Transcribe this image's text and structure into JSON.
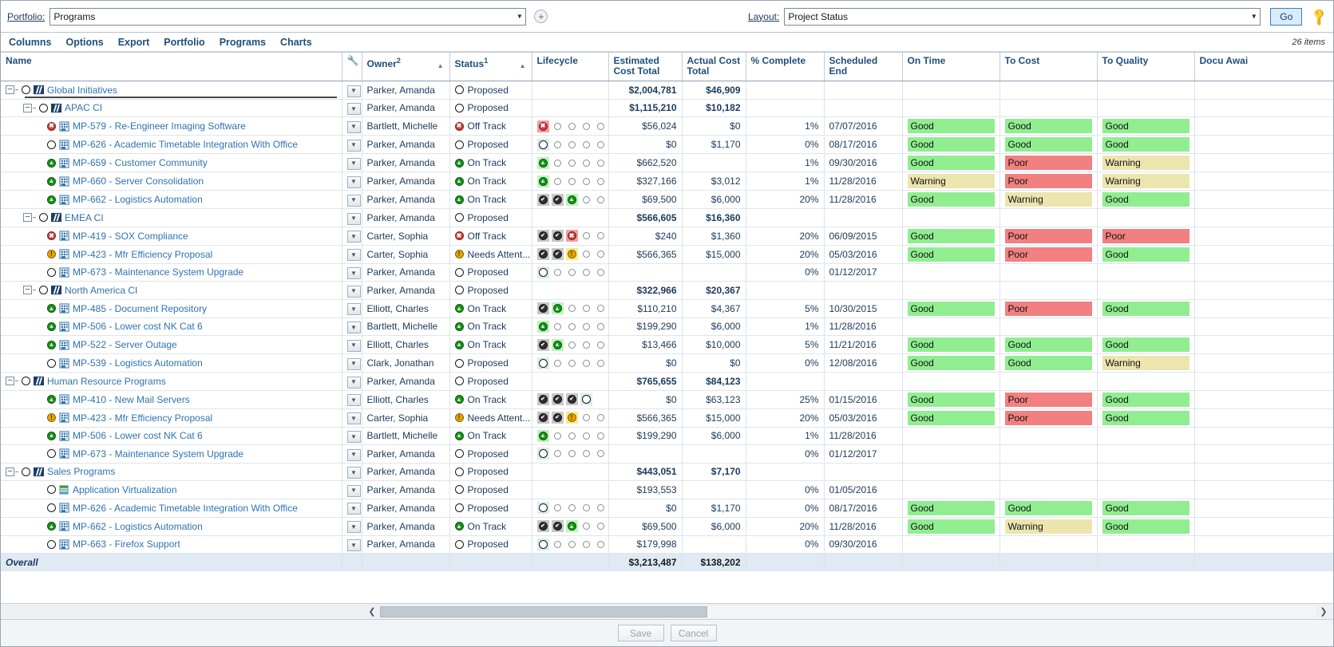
{
  "topbar": {
    "portfolio_label": "Portfolio:",
    "portfolio_value": "Programs",
    "add_portfolio_icon": "plus-circle-icon",
    "layout_label": "Layout:",
    "layout_value": "Project Status",
    "go_label": "Go",
    "key_icon": "key-icon"
  },
  "menubar": {
    "items": [
      {
        "label": "Columns"
      },
      {
        "label": "Options"
      },
      {
        "label": "Export"
      },
      {
        "label": "Portfolio"
      },
      {
        "label": "Programs"
      },
      {
        "label": "Charts"
      }
    ],
    "item_count": "26 items"
  },
  "columns": [
    {
      "label": "Name",
      "sort": ""
    },
    {
      "label": "",
      "icon": "wrench-icon",
      "sort": ""
    },
    {
      "label": "Owner",
      "sup": "2",
      "sort": "asc"
    },
    {
      "label": "Status",
      "sup": "1",
      "sort": "asc"
    },
    {
      "label": "Lifecycle",
      "sort": ""
    },
    {
      "label": "Estimated Cost Total",
      "sort": ""
    },
    {
      "label": "Actual Cost Total",
      "sort": ""
    },
    {
      "label": "% Complete",
      "sort": ""
    },
    {
      "label": "Scheduled End",
      "sort": ""
    },
    {
      "label": "On Time",
      "sort": ""
    },
    {
      "label": "To Cost",
      "sort": ""
    },
    {
      "label": "To Quality",
      "sort": ""
    },
    {
      "label": "Docu Awai",
      "sort": "asc"
    }
  ],
  "rows": [
    {
      "level": 0,
      "expander": true,
      "dot": "open",
      "icon": "program-icon",
      "name": "Global Initiatives",
      "group": true,
      "titlerule": true,
      "owner": "Parker, Amanda",
      "status_glyph": "open",
      "status": "Proposed",
      "lifecycle": [],
      "est": "$2,004,781",
      "act": "$46,909",
      "pct": "",
      "end": "",
      "ontime": "",
      "tocost": "",
      "toquality": ""
    },
    {
      "level": 1,
      "expander": true,
      "dot": "open",
      "icon": "program-icon",
      "name": "APAC CI",
      "group": true,
      "owner": "Parker, Amanda",
      "status_glyph": "open",
      "status": "Proposed",
      "lifecycle": [],
      "est": "$1,115,210",
      "act": "$10,182",
      "pct": "",
      "end": "",
      "ontime": "",
      "tocost": "",
      "toquality": ""
    },
    {
      "level": 2,
      "dot": "red",
      "icon": "project-icon",
      "name": "MP-579 - Re-Engineer Imaging Software",
      "owner": "Bartlett, Michelle",
      "status_glyph": "red",
      "status": "Off Track",
      "lifecycle": [
        "cur-red",
        "ring",
        "ring",
        "ring",
        "ring"
      ],
      "est": "$56,024",
      "act": "$0",
      "pct": "1%",
      "end": "07/07/2016",
      "ontime": "Good",
      "tocost": "Good",
      "toquality": "Good"
    },
    {
      "level": 2,
      "dot": "open",
      "icon": "project-icon",
      "name": "MP-626 - Academic Timetable Integration With Office",
      "owner": "Parker, Amanda",
      "status_glyph": "open",
      "status": "Proposed",
      "lifecycle": [
        "cur-empty",
        "ring",
        "ring",
        "ring",
        "ring"
      ],
      "est": "$0",
      "act": "$1,170",
      "pct": "0%",
      "end": "08/17/2016",
      "ontime": "Good",
      "tocost": "Good",
      "toquality": "Good"
    },
    {
      "level": 2,
      "dot": "green",
      "icon": "project-icon",
      "name": "MP-659 - Customer Community",
      "owner": "Parker, Amanda",
      "status_glyph": "green",
      "status": "On Track",
      "lifecycle": [
        "cur-green",
        "ring",
        "ring",
        "ring",
        "ring"
      ],
      "est": "$662,520",
      "act": "",
      "pct": "1%",
      "end": "09/30/2016",
      "ontime": "Good",
      "tocost": "Poor",
      "toquality": "Warning"
    },
    {
      "level": 2,
      "dot": "green",
      "icon": "project-icon",
      "name": "MP-660 - Server Consolidation",
      "owner": "Parker, Amanda",
      "status_glyph": "green",
      "status": "On Track",
      "lifecycle": [
        "cur-green",
        "ring",
        "ring",
        "ring",
        "ring"
      ],
      "est": "$327,166",
      "act": "$3,012",
      "pct": "1%",
      "end": "11/28/2016",
      "ontime": "Warning",
      "tocost": "Poor",
      "toquality": "Warning"
    },
    {
      "level": 2,
      "dot": "green",
      "icon": "project-icon",
      "name": "MP-662 - Logistics Automation",
      "owner": "Parker, Amanda",
      "status_glyph": "green",
      "status": "On Track",
      "lifecycle": [
        "check",
        "check",
        "cur-green",
        "ring",
        "ring"
      ],
      "est": "$69,500",
      "act": "$6,000",
      "pct": "20%",
      "end": "11/28/2016",
      "ontime": "Good",
      "tocost": "Warning",
      "toquality": "Good"
    },
    {
      "level": 1,
      "expander": true,
      "dot": "open",
      "icon": "program-icon",
      "name": "EMEA CI",
      "group": true,
      "owner": "Parker, Amanda",
      "status_glyph": "open",
      "status": "Proposed",
      "lifecycle": [],
      "est": "$566,605",
      "act": "$16,360",
      "pct": "",
      "end": "",
      "ontime": "",
      "tocost": "",
      "toquality": ""
    },
    {
      "level": 2,
      "dot": "red",
      "icon": "project-icon",
      "name": "MP-419 - SOX Compliance",
      "owner": "Carter, Sophia",
      "status_glyph": "red",
      "status": "Off Track",
      "lifecycle": [
        "check",
        "check",
        "cur-red",
        "ring",
        "ring"
      ],
      "est": "$240",
      "act": "$1,360",
      "pct": "20%",
      "end": "06/09/2015",
      "ontime": "Good",
      "tocost": "Poor",
      "toquality": "Poor"
    },
    {
      "level": 2,
      "dot": "amber",
      "icon": "project-icon",
      "name": "MP-423 - Mfr Efficiency Proposal",
      "owner": "Carter, Sophia",
      "status_glyph": "amber",
      "status": "Needs Attent...",
      "lifecycle": [
        "check",
        "check",
        "cur-amber",
        "ring",
        "ring"
      ],
      "est": "$566,365",
      "act": "$15,000",
      "pct": "20%",
      "end": "05/03/2016",
      "ontime": "Good",
      "tocost": "Poor",
      "toquality": "Good"
    },
    {
      "level": 2,
      "dot": "open",
      "icon": "project-icon",
      "name": "MP-673 - Maintenance System Upgrade",
      "owner": "Parker, Amanda",
      "status_glyph": "open",
      "status": "Proposed",
      "lifecycle": [
        "cur-empty",
        "ring",
        "ring",
        "ring",
        "ring"
      ],
      "est": "",
      "act": "",
      "pct": "0%",
      "end": "01/12/2017",
      "ontime": "",
      "tocost": "",
      "toquality": ""
    },
    {
      "level": 1,
      "expander": true,
      "dot": "open",
      "icon": "program-icon",
      "name": "North America CI",
      "group": true,
      "owner": "Parker, Amanda",
      "status_glyph": "open",
      "status": "Proposed",
      "lifecycle": [],
      "est": "$322,966",
      "act": "$20,367",
      "pct": "",
      "end": "",
      "ontime": "",
      "tocost": "",
      "toquality": ""
    },
    {
      "level": 2,
      "dot": "green",
      "icon": "project-icon",
      "name": "MP-485 - Document Repository",
      "owner": "Elliott, Charles",
      "status_glyph": "green",
      "status": "On Track",
      "lifecycle": [
        "check",
        "cur-green",
        "ring",
        "ring",
        "ring"
      ],
      "est": "$110,210",
      "act": "$4,367",
      "pct": "5%",
      "end": "10/30/2015",
      "ontime": "Good",
      "tocost": "Poor",
      "toquality": "Good"
    },
    {
      "level": 2,
      "dot": "green",
      "icon": "project-icon",
      "name": "MP-506 - Lower cost NK Cat 6",
      "owner": "Bartlett, Michelle",
      "status_glyph": "green",
      "status": "On Track",
      "lifecycle": [
        "cur-green",
        "ring",
        "ring",
        "ring",
        "ring"
      ],
      "est": "$199,290",
      "act": "$6,000",
      "pct": "1%",
      "end": "11/28/2016",
      "ontime": "",
      "tocost": "",
      "toquality": ""
    },
    {
      "level": 2,
      "dot": "green",
      "icon": "project-icon",
      "name": "MP-522 - Server Outage",
      "owner": "Elliott, Charles",
      "status_glyph": "green",
      "status": "On Track",
      "lifecycle": [
        "check",
        "cur-green",
        "ring",
        "ring",
        "ring"
      ],
      "est": "$13,466",
      "act": "$10,000",
      "pct": "5%",
      "end": "11/21/2016",
      "ontime": "Good",
      "tocost": "Good",
      "toquality": "Good"
    },
    {
      "level": 2,
      "dot": "open",
      "icon": "project-icon",
      "name": "MP-539 - Logistics Automation",
      "owner": "Clark, Jonathan",
      "status_glyph": "open",
      "status": "Proposed",
      "lifecycle": [
        "cur-empty",
        "ring",
        "ring",
        "ring",
        "ring"
      ],
      "est": "$0",
      "act": "$0",
      "pct": "0%",
      "end": "12/08/2016",
      "ontime": "Good",
      "tocost": "Good",
      "toquality": "Warning"
    },
    {
      "level": 0,
      "expander": true,
      "dot": "open",
      "icon": "program-icon",
      "name": "Human Resource Programs",
      "group": true,
      "owner": "Parker, Amanda",
      "status_glyph": "open",
      "status": "Proposed",
      "lifecycle": [],
      "est": "$765,655",
      "act": "$84,123",
      "pct": "",
      "end": "",
      "ontime": "",
      "tocost": "",
      "toquality": ""
    },
    {
      "level": 2,
      "dot": "green",
      "icon": "project-icon",
      "name": "MP-410 - New Mail Servers",
      "owner": "Elliott, Charles",
      "status_glyph": "green",
      "status": "On Track",
      "lifecycle": [
        "check",
        "done",
        "check",
        "cur-empty"
      ],
      "est": "$0",
      "act": "$63,123",
      "pct": "25%",
      "end": "01/15/2016",
      "ontime": "Good",
      "tocost": "Poor",
      "toquality": "Good"
    },
    {
      "level": 2,
      "dot": "amber",
      "icon": "project-icon",
      "name": "MP-423 - Mfr Efficiency Proposal",
      "owner": "Carter, Sophia",
      "status_glyph": "amber",
      "status": "Needs Attent...",
      "lifecycle": [
        "check",
        "check",
        "cur-amber",
        "ring",
        "ring"
      ],
      "est": "$566,365",
      "act": "$15,000",
      "pct": "20%",
      "end": "05/03/2016",
      "ontime": "Good",
      "tocost": "Poor",
      "toquality": "Good"
    },
    {
      "level": 2,
      "dot": "green",
      "icon": "project-icon",
      "name": "MP-506 - Lower cost NK Cat 6",
      "owner": "Bartlett, Michelle",
      "status_glyph": "green",
      "status": "On Track",
      "lifecycle": [
        "cur-green",
        "ring",
        "ring",
        "ring",
        "ring"
      ],
      "est": "$199,290",
      "act": "$6,000",
      "pct": "1%",
      "end": "11/28/2016",
      "ontime": "",
      "tocost": "",
      "toquality": ""
    },
    {
      "level": 2,
      "dot": "open",
      "icon": "project-icon",
      "name": "MP-673 - Maintenance System Upgrade",
      "owner": "Parker, Amanda",
      "status_glyph": "open",
      "status": "Proposed",
      "lifecycle": [
        "cur-empty",
        "ring",
        "ring",
        "ring",
        "ring"
      ],
      "est": "",
      "act": "",
      "pct": "0%",
      "end": "01/12/2017",
      "ontime": "",
      "tocost": "",
      "toquality": ""
    },
    {
      "level": 0,
      "expander": true,
      "dot": "open",
      "icon": "program-icon",
      "name": "Sales Programs",
      "group": true,
      "owner": "Parker, Amanda",
      "status_glyph": "open",
      "status": "Proposed",
      "lifecycle": [],
      "est": "$443,051",
      "act": "$7,170",
      "pct": "",
      "end": "",
      "ontime": "",
      "tocost": "",
      "toquality": ""
    },
    {
      "level": 2,
      "dot": "open",
      "icon": "app-icon",
      "name": "Application Virtualization",
      "owner": "Parker, Amanda",
      "status_glyph": "open",
      "status": "Proposed",
      "lifecycle": [],
      "est": "$193,553",
      "act": "",
      "pct": "0%",
      "end": "01/05/2016",
      "ontime": "",
      "tocost": "",
      "toquality": ""
    },
    {
      "level": 2,
      "dot": "open",
      "icon": "project-icon",
      "name": "MP-626 - Academic Timetable Integration With Office",
      "owner": "Parker, Amanda",
      "status_glyph": "open",
      "status": "Proposed",
      "lifecycle": [
        "cur-empty",
        "ring",
        "ring",
        "ring",
        "ring"
      ],
      "est": "$0",
      "act": "$1,170",
      "pct": "0%",
      "end": "08/17/2016",
      "ontime": "Good",
      "tocost": "Good",
      "toquality": "Good"
    },
    {
      "level": 2,
      "dot": "green",
      "icon": "project-icon",
      "name": "MP-662 - Logistics Automation",
      "owner": "Parker, Amanda",
      "status_glyph": "green",
      "status": "On Track",
      "lifecycle": [
        "check",
        "check",
        "cur-green",
        "ring",
        "ring"
      ],
      "est": "$69,500",
      "act": "$6,000",
      "pct": "20%",
      "end": "11/28/2016",
      "ontime": "Good",
      "tocost": "Warning",
      "toquality": "Good"
    },
    {
      "level": 2,
      "dot": "open",
      "icon": "project-icon",
      "name": "MP-663 - Firefox Support",
      "owner": "Parker, Amanda",
      "status_glyph": "open",
      "status": "Proposed",
      "lifecycle": [
        "cur-empty",
        "ring",
        "ring",
        "ring",
        "ring"
      ],
      "est": "$179,998",
      "act": "",
      "pct": "0%",
      "end": "09/30/2016",
      "ontime": "",
      "tocost": "",
      "toquality": ""
    }
  ],
  "overall": {
    "label": "Overall",
    "est": "$3,213,487",
    "act": "$138,202"
  },
  "footer": {
    "save_label": "Save",
    "cancel_label": "Cancel"
  },
  "scrollbar": {
    "left_arrow": "chevron-left-icon",
    "right_arrow": "chevron-right-icon"
  },
  "colors": {
    "good": "#90ee90",
    "poor": "#f28080",
    "warning": "#ece5ae",
    "link": "#2f73b0",
    "header_text": "#1f4e79",
    "overall_bg": "#dfeaf4"
  }
}
